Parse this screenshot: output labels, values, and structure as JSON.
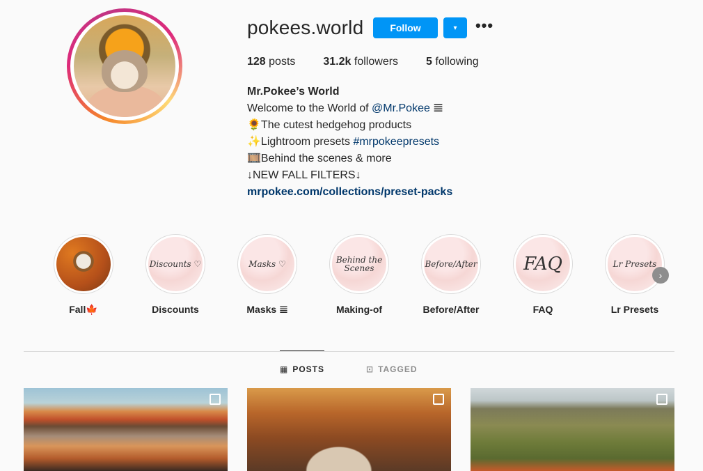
{
  "profile": {
    "username": "pokees.world",
    "follow_label": "Follow",
    "dropdown_icon": "▾",
    "more_icon": "•••",
    "stats": {
      "posts_count": "128",
      "posts_label": "posts",
      "followers_count": "31.2k",
      "followers_label": "followers",
      "following_count": "5",
      "following_label": "following"
    },
    "bio": {
      "name": "Mr.Pokee’s World",
      "line1_text": "Welcome to the World of ",
      "line1_mention": "@Mr.Pokee",
      "line1_emoji": "𝌆",
      "line2": "🌻The cutest hedgehog products",
      "line3_text": "✨Lightroom presets ",
      "line3_tag": "#mrpokeepresets",
      "line4": "🎞️Behind the scenes & more",
      "line5": "↓NEW FALL FILTERS↓",
      "link": "mrpokee.com/collections/preset-packs"
    }
  },
  "highlights": [
    {
      "label": "Fall🍁",
      "cover_text": ""
    },
    {
      "label": "Discounts",
      "cover_text": "Discounts ♡"
    },
    {
      "label": "Masks 𝌆",
      "cover_text": "Masks ♡"
    },
    {
      "label": "Making-of",
      "cover_text": "Behind the Scenes"
    },
    {
      "label": "Before/After",
      "cover_text": "Before/After"
    },
    {
      "label": "FAQ",
      "cover_text": "FAQ"
    },
    {
      "label": "Lr Presets",
      "cover_text": "Lr Presets"
    }
  ],
  "highlights_next_icon": "›",
  "tabs": {
    "posts_label": "POSTS",
    "posts_icon": "▦",
    "tagged_label": "TAGGED",
    "tagged_icon": "⊡"
  },
  "colors": {
    "accent": "#0095f6",
    "link": "#00376b"
  }
}
